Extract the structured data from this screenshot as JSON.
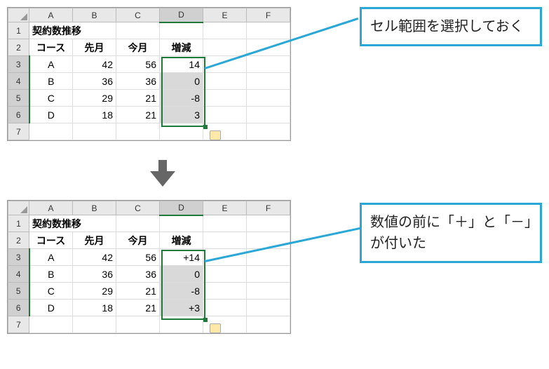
{
  "columns": [
    "A",
    "B",
    "C",
    "D",
    "E",
    "F"
  ],
  "rows": [
    "1",
    "2",
    "3",
    "4",
    "5",
    "6",
    "7"
  ],
  "title": "契約数推移",
  "headers": {
    "course": "コース",
    "prev": "先月",
    "curr": "今月",
    "diff": "増減"
  },
  "data": [
    {
      "course": "A",
      "prev": 42,
      "curr": 56,
      "diff": 14
    },
    {
      "course": "B",
      "prev": 36,
      "curr": 36,
      "diff": 0
    },
    {
      "course": "C",
      "prev": 29,
      "curr": 21,
      "diff": -8
    },
    {
      "course": "D",
      "prev": 18,
      "curr": 21,
      "diff": 3
    }
  ],
  "diff_formatted_before": [
    "14",
    "0",
    "-8",
    "3"
  ],
  "diff_formatted_after": [
    "+14",
    "0",
    "-8",
    "+3"
  ],
  "callout1": "セル範囲を選択しておく",
  "callout2": "数値の前に「＋」と「－」が付いた"
}
